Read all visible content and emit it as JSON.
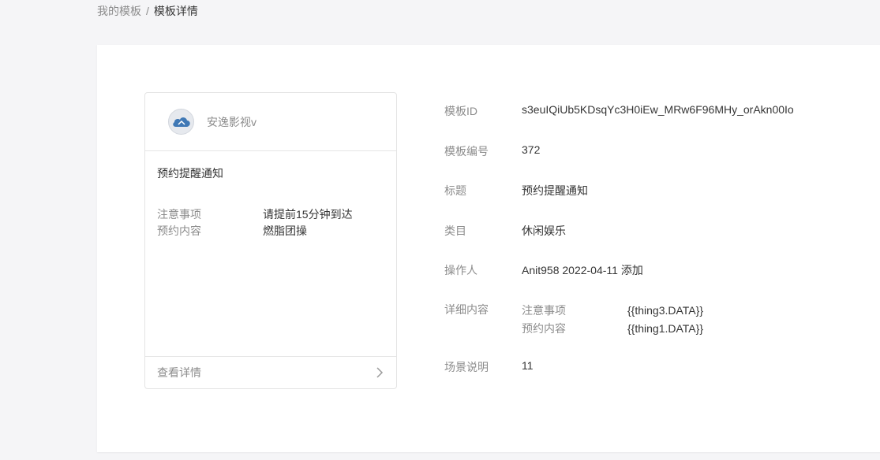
{
  "breadcrumb": {
    "parent": "我的模板",
    "separator": "/",
    "current": "模板详情"
  },
  "preview": {
    "account_name": "安逸影视v",
    "title": "预约提醒通知",
    "fields": [
      {
        "key": "注意事项",
        "value": "请提前15分钟到达"
      },
      {
        "key": "预约内容",
        "value": "燃脂团操"
      }
    ],
    "footer_label": "查看详情",
    "footer_icon": "chevron-right-icon"
  },
  "details": {
    "template_id": {
      "label": "模板ID",
      "value": "s3euIQiUb5KDsqYc3H0iEw_MRw6F96MHy_orAkn00Io"
    },
    "template_number": {
      "label": "模板编号",
      "value": "372"
    },
    "title": {
      "label": "标题",
      "value": "预约提醒通知"
    },
    "category": {
      "label": "类目",
      "value": "休闲娱乐"
    },
    "operator": {
      "label": "操作人",
      "value": "Anit958 2022-04-11 添加"
    },
    "content": {
      "label": "详细内容",
      "items": [
        {
          "key": "注意事项",
          "value": "{{thing3.DATA}}"
        },
        {
          "key": "预约内容",
          "value": "{{thing1.DATA}}"
        }
      ]
    },
    "scene": {
      "label": "场景说明",
      "value": "11"
    }
  },
  "colors": {
    "page_bg": "#f5f5f7",
    "panel_bg": "#ffffff",
    "muted_text": "#8c8c8c",
    "main_text": "#353535",
    "border": "#e4e4e4"
  }
}
